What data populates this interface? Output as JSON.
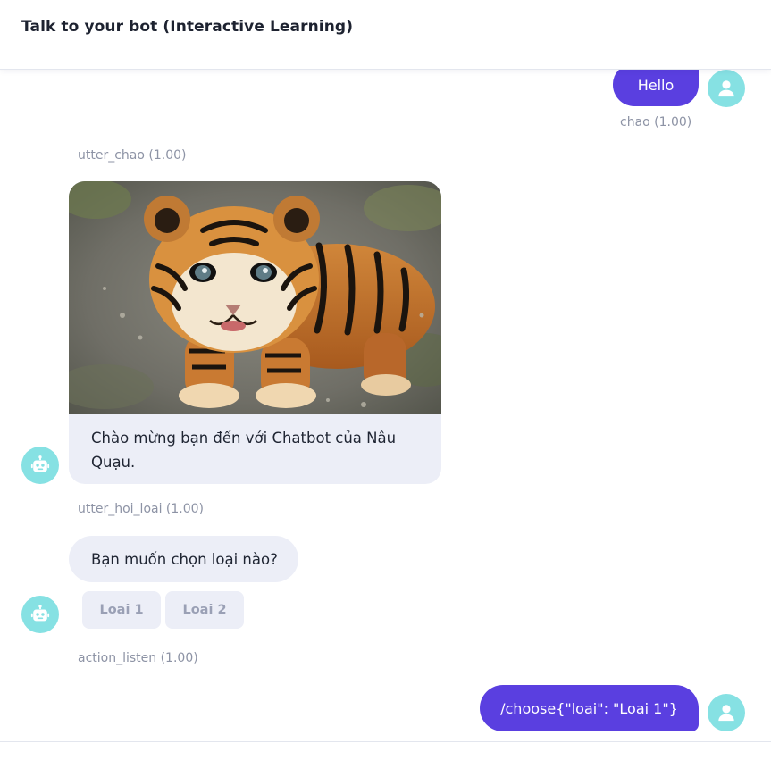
{
  "header": {
    "title": "Talk to your bot (Interactive Learning)"
  },
  "messages": {
    "user_1": {
      "text": "Hello",
      "intent": "chao (1.00)"
    },
    "bot_1": {
      "action": "utter_chao (1.00)",
      "text": "Chào mừng bạn đến với Chatbot của Nâu Quạu.",
      "image": "tiger cub photo"
    },
    "bot_2": {
      "action": "utter_hoi_loai (1.00)",
      "text": "Bạn muốn chọn loại nào?",
      "buttons": [
        "Loai 1",
        "Loai 2"
      ]
    },
    "bot_3": {
      "action": "action_listen (1.00)"
    },
    "user_2": {
      "text": "/choose{\"loai\": \"Loai 1\"}"
    }
  },
  "icons": {
    "user_avatar": "user-icon",
    "bot_avatar": "robot-icon"
  },
  "colors": {
    "user_bubble": "#5a3fe0",
    "avatar": "#86e1e3",
    "bot_bubble": "#eceef7"
  }
}
